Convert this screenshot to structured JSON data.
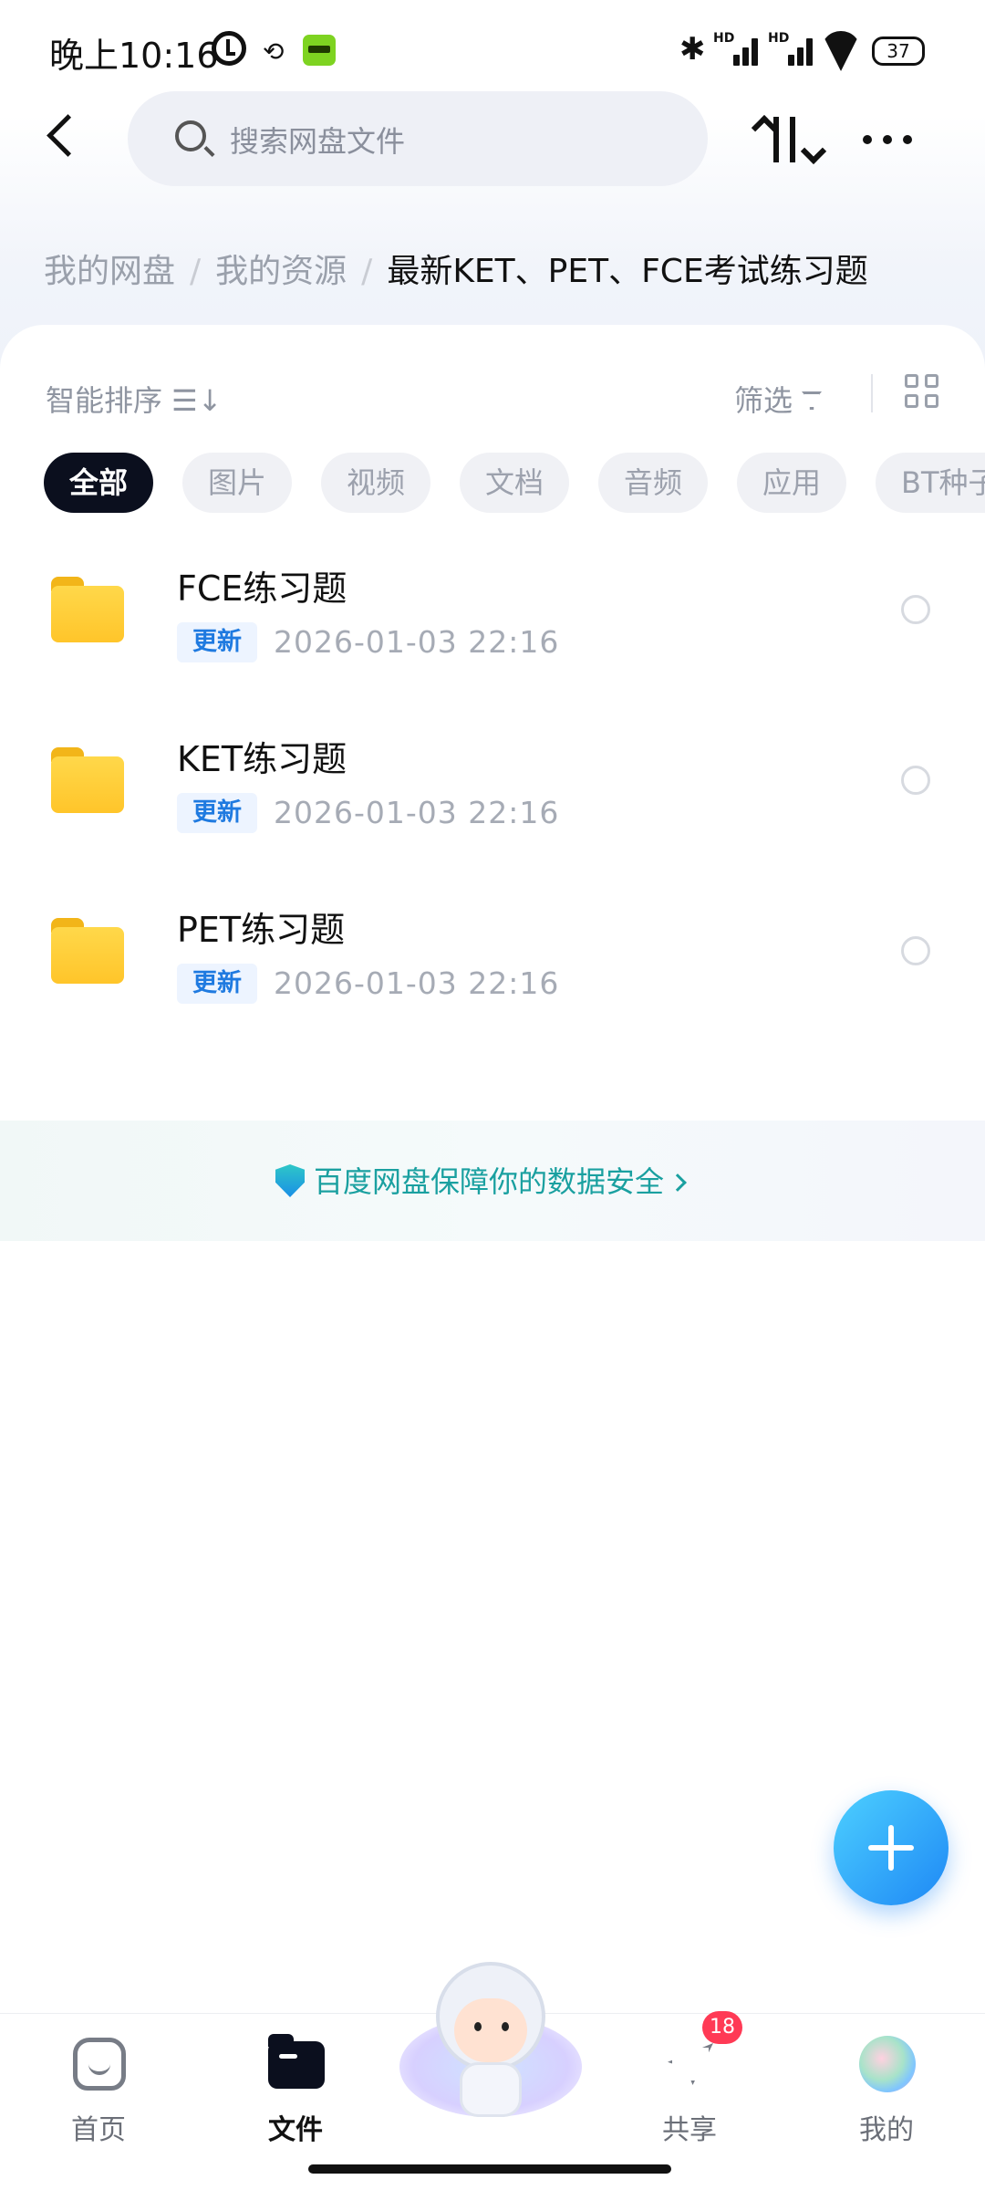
{
  "status_bar": {
    "time": "晚上10:16",
    "battery": "37",
    "icons": [
      "alarm-icon",
      "sync-icon",
      "app-badge-icon",
      "bluetooth-icon",
      "hd-signal-icon",
      "hd-signal-icon",
      "wifi-icon",
      "battery-icon"
    ]
  },
  "header": {
    "search_placeholder": "搜索网盘文件",
    "icons": [
      "back-icon",
      "search-icon",
      "sort-icon",
      "more-icon"
    ]
  },
  "breadcrumb": {
    "items": [
      "我的网盘",
      "我的资源",
      "最新KET、PET、FCE考试练习题"
    ],
    "separator": "/"
  },
  "toolbar": {
    "sort_label": "智能排序",
    "filter_label": "筛选"
  },
  "chips": [
    {
      "label": "全部",
      "active": true
    },
    {
      "label": "图片",
      "active": false
    },
    {
      "label": "视频",
      "active": false
    },
    {
      "label": "文档",
      "active": false
    },
    {
      "label": "音频",
      "active": false
    },
    {
      "label": "应用",
      "active": false
    },
    {
      "label": "BT种子",
      "active": false
    }
  ],
  "files": [
    {
      "name": "FCE练习题",
      "tag": "更新",
      "date": "2026-01-03  22:16",
      "type": "folder"
    },
    {
      "name": "KET练习题",
      "tag": "更新",
      "date": "2026-01-03  22:16",
      "type": "folder"
    },
    {
      "name": "PET练习题",
      "tag": "更新",
      "date": "2026-01-03  22:16",
      "type": "folder"
    }
  ],
  "security_banner": {
    "text": "百度网盘保障你的数据安全"
  },
  "bottom_nav": {
    "items": [
      {
        "label": "首页",
        "icon": "home-icon",
        "active": false
      },
      {
        "label": "文件",
        "icon": "files-icon",
        "active": true
      },
      {
        "label": "共享",
        "icon": "share-icon",
        "active": false,
        "badge": "18"
      },
      {
        "label": "我的",
        "icon": "avatar",
        "active": false
      }
    ]
  },
  "colors": {
    "accent": "#1e88f5",
    "tag_text": "#1f7ae0",
    "security_text": "#1aa0a0",
    "badge": "#ff3a55",
    "active_chip": "#0b0f1e"
  }
}
